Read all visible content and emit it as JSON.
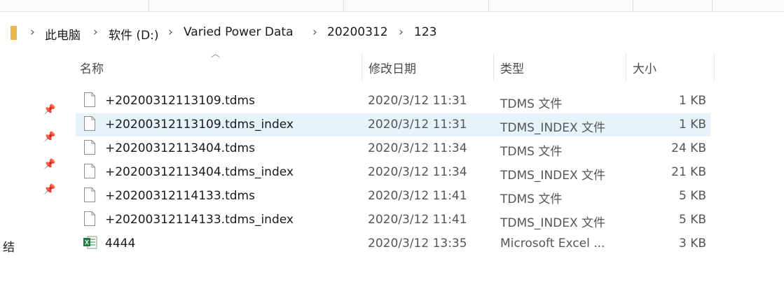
{
  "breadcrumb": [
    "此电脑",
    "软件 (D:)",
    "Varied Power Data",
    "20200312",
    "123"
  ],
  "columns": {
    "name": "名称",
    "date": "修改日期",
    "type": "类型",
    "size": "大小"
  },
  "files": [
    {
      "name": "+20200312113109.tdms",
      "date": "2020/3/12 11:31",
      "type": "TDMS 文件",
      "size": "1 KB",
      "icon": "file-icon",
      "selected": false
    },
    {
      "name": "+20200312113109.tdms_index",
      "date": "2020/3/12 11:31",
      "type": "TDMS_INDEX 文件",
      "size": "1 KB",
      "icon": "file-icon",
      "selected": true
    },
    {
      "name": "+20200312113404.tdms",
      "date": "2020/3/12 11:34",
      "type": "TDMS 文件",
      "size": "24 KB",
      "icon": "file-icon",
      "selected": false
    },
    {
      "name": "+20200312113404.tdms_index",
      "date": "2020/3/12 11:34",
      "type": "TDMS_INDEX 文件",
      "size": "21 KB",
      "icon": "file-icon",
      "selected": false
    },
    {
      "name": "+20200312114133.tdms",
      "date": "2020/3/12 11:41",
      "type": "TDMS 文件",
      "size": "5 KB",
      "icon": "file-icon",
      "selected": false
    },
    {
      "name": "+20200312114133.tdms_index",
      "date": "2020/3/12 11:41",
      "type": "TDMS_INDEX 文件",
      "size": "5 KB",
      "icon": "file-icon",
      "selected": false
    },
    {
      "name": "4444",
      "date": "2020/3/12 13:35",
      "type": "Microsoft Excel ...",
      "size": "3 KB",
      "icon": "excel-icon",
      "selected": false
    }
  ],
  "sidebar": {
    "partial_label": "结"
  },
  "colors": {
    "selection": "#e5f3fb",
    "folder": "#e8b84a"
  }
}
